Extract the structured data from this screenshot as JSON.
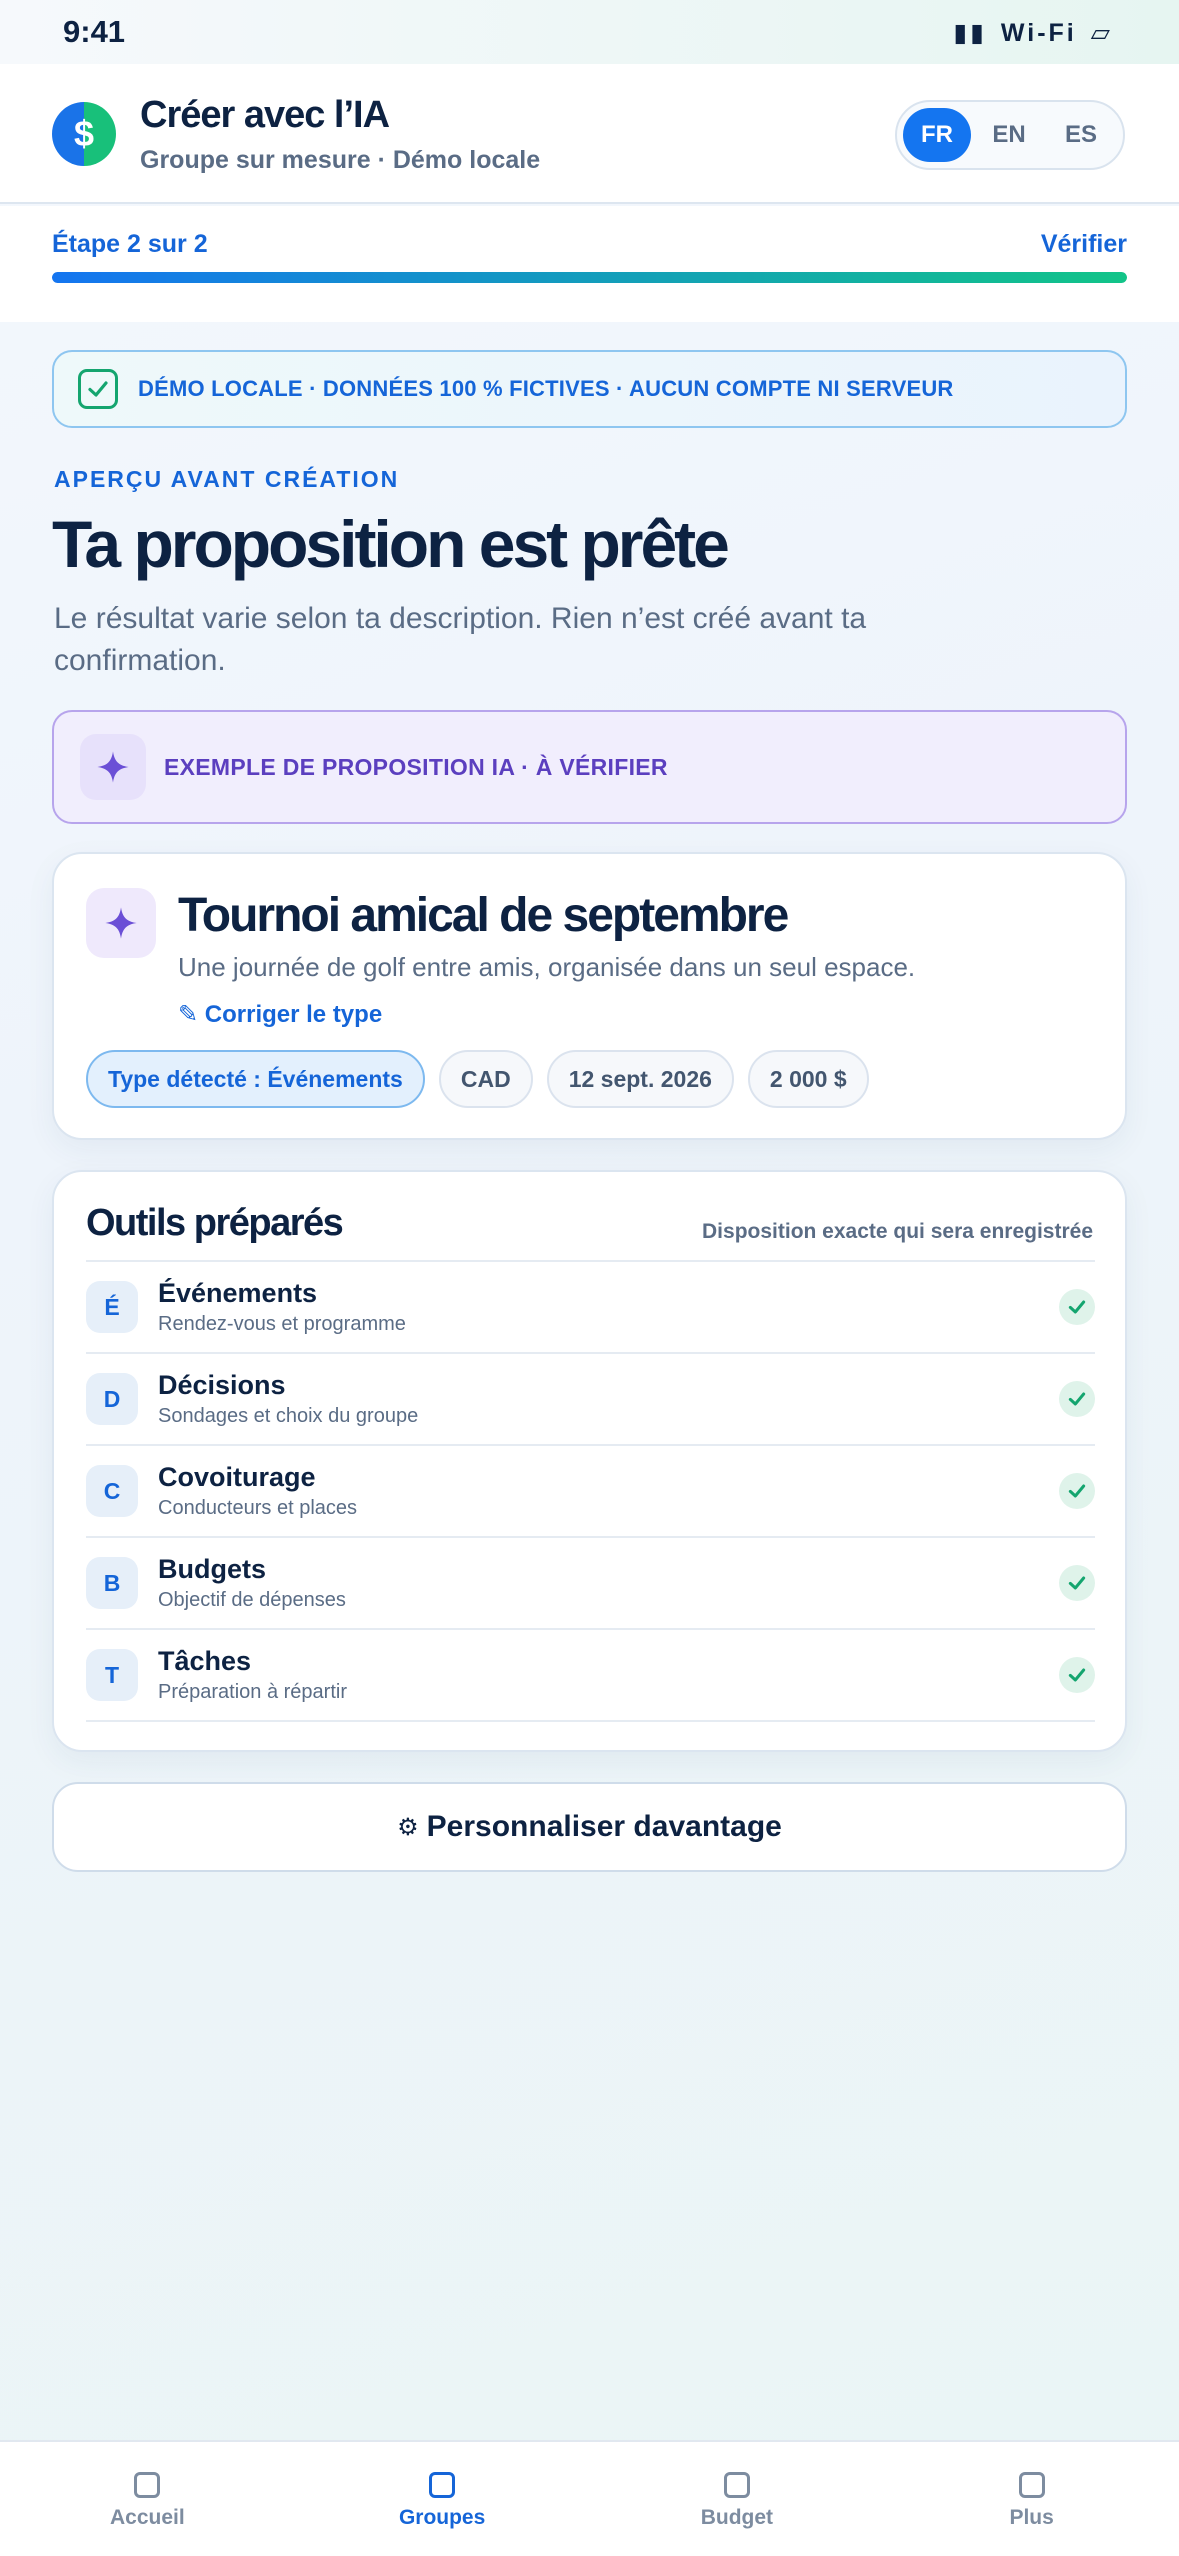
{
  "status_bar": {
    "time": "9:41",
    "signal": "▮▮",
    "wifi": "Wi-Fi",
    "battery": "▱"
  },
  "header": {
    "logo_glyph": "$",
    "title": "Créer avec l’IA",
    "subtitle": "Groupe sur mesure · Démo locale",
    "languages": [
      {
        "code": "FR",
        "active": true
      },
      {
        "code": "EN",
        "active": false
      },
      {
        "code": "ES",
        "active": false
      }
    ]
  },
  "step": {
    "label": "Étape 2 sur 2",
    "action": "Vérifier",
    "progress": 1.0
  },
  "demo_banner": {
    "icon": "check-square-icon",
    "text": "DÉMO LOCALE · DONNÉES 100 % FICTIVES · AUCUN COMPTE NI SERVEUR"
  },
  "intro": {
    "eyebrow": "APERÇU AVANT CRÉATION",
    "title": "Ta proposition est prête",
    "subtitle": "Le résultat varie selon ta description. Rien n’est créé avant ta confirmation."
  },
  "ai_banner": {
    "icon": "sparkle-icon",
    "text": "EXEMPLE DE PROPOSITION IA · À VÉRIFIER"
  },
  "proposal": {
    "icon": "sparkle-icon",
    "title": "Tournoi amical de septembre",
    "description": "Une journée de golf entre amis, organisée dans un seul espace.",
    "fix_type_link": "✎ Corriger le type",
    "chips": [
      "Type détecté : Événements",
      "CAD",
      "12 sept. 2026",
      "2 000 $"
    ]
  },
  "tools": {
    "title": "Outils préparés",
    "note": "Disposition exacte qui sera enregistrée",
    "items": [
      {
        "letter": "É",
        "name": "Événements",
        "desc": "Rendez-vous et programme"
      },
      {
        "letter": "D",
        "name": "Décisions",
        "desc": "Sondages et choix du groupe"
      },
      {
        "letter": "C",
        "name": "Covoiturage",
        "desc": "Conducteurs et places"
      },
      {
        "letter": "B",
        "name": "Budgets",
        "desc": "Objectif de dépenses"
      },
      {
        "letter": "T",
        "name": "Tâches",
        "desc": "Préparation à répartir"
      }
    ]
  },
  "personalize_button": {
    "icon": "⚙",
    "label": "Personnaliser davantage"
  },
  "bottom_nav": {
    "items": [
      {
        "label": "Accueil",
        "active": false
      },
      {
        "label": "Groupes",
        "active": true
      },
      {
        "label": "Budget",
        "active": false
      },
      {
        "label": "Plus",
        "active": false
      }
    ]
  },
  "colors": {
    "accent": "#1565d8",
    "success": "#14a56f",
    "ai_purple": "#5b3fbf",
    "text_dark": "#0d2242"
  }
}
